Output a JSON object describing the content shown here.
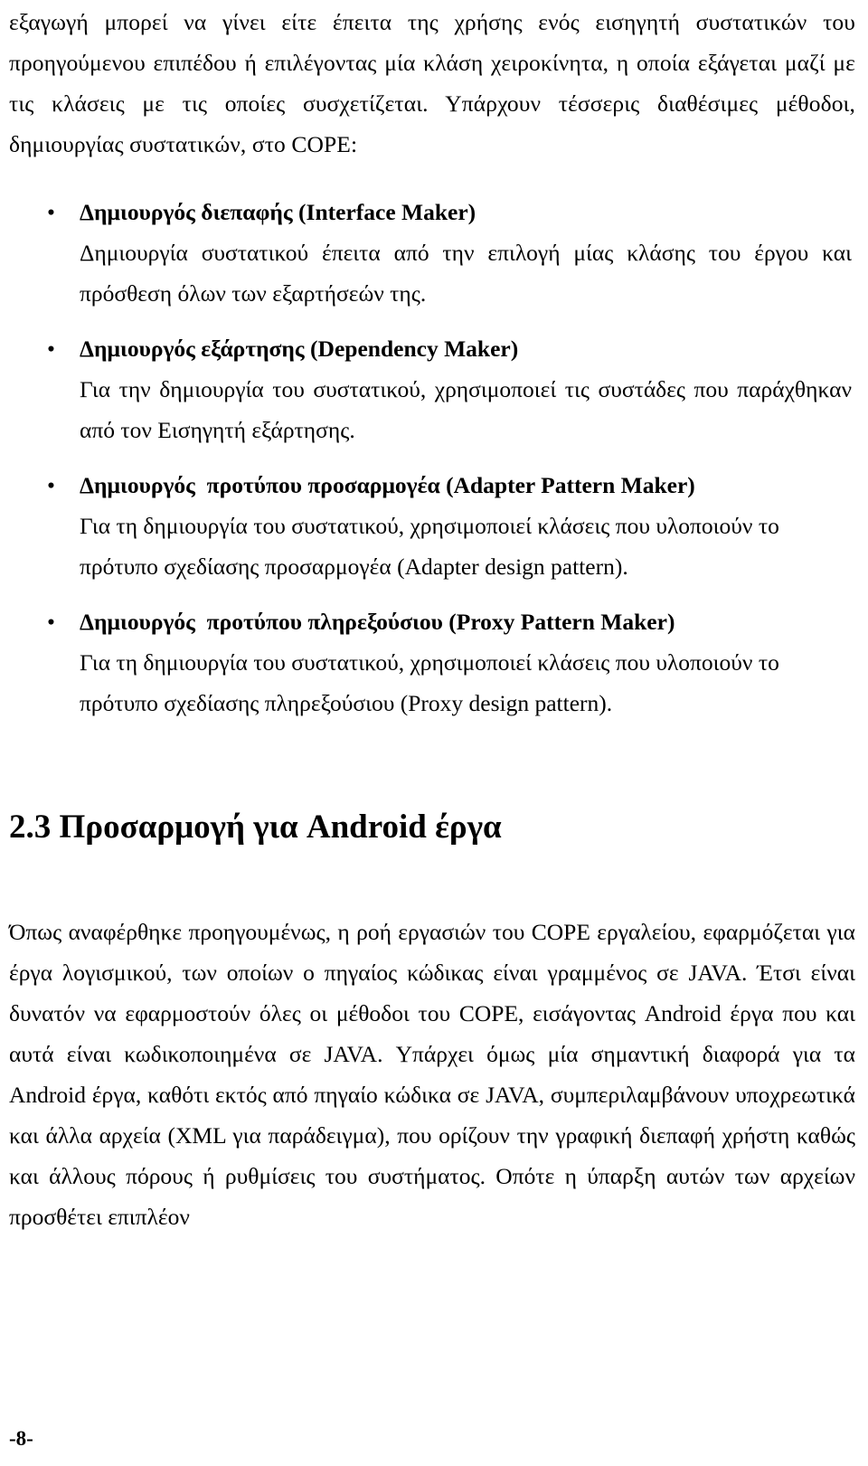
{
  "document": {
    "page_number_label": "-8-",
    "intro_paragraph": "εξαγωγή μπορεί να γίνει είτε έπειτα της χρήσης ενός εισηγητή συστατικών του προηγούμενου επιπέδου ή επιλέγοντας μία κλάση χειροκίνητα, η οποία εξάγεται μαζί με τις κλάσεις με τις οποίες συσχετίζεται. Υπάρχουν τέσσερις διαθέσιμες μέθοδοι, δημιουργίας συστατικών, στο COPE:",
    "bullet_marker": "•",
    "bullets": [
      {
        "title": "Δημιουργός διεπαφής (Interface Maker)",
        "body": "Δημιουργία συστατικού έπειτα από την επιλογή μίας κλάσης του έργου και πρόσθεση όλων των εξαρτήσεών της."
      },
      {
        "title": "Δημιουργός εξάρτησης (Dependency Maker)",
        "body": "Για την δημιουργία του συστατικού, χρησιμοποιεί τις συστάδες που παράχθηκαν από τον Εισηγητή εξάρτησης."
      },
      {
        "title": "Δημιουργός  προτύπου προσαρμογέα (Adapter Pattern Maker)",
        "body": "Για τη δημιουργία του συστατικού, χρησιμοποιεί κλάσεις που υλοποιούν το πρότυπο σχεδίασης προσαρμογέα (Adapter design pattern)."
      },
      {
        "title": "Δημιουργός  προτύπου πληρεξούσιου (Proxy Pattern Maker)",
        "body": "Για τη δημιουργία του συστατικού, χρησιμοποιεί κλάσεις που υλοποιούν το πρότυπο σχεδίασης πληρεξούσιου (Proxy design pattern)."
      }
    ],
    "section_heading": "2.3 Προσαρμογή για Android έργα",
    "closing_paragraph": "Όπως αναφέρθηκε προηγουμένως, η ροή εργασιών του COPE εργαλείου, εφαρμόζεται για έργα λογισμικού, των οποίων ο πηγαίος κώδικας είναι γραμμένος σε JAVA. Έτσι είναι δυνατόν να εφαρμοστούν όλες οι μέθοδοι του COPE, εισάγοντας Android έργα που και αυτά είναι κωδικοποιημένα σε JAVA. Υπάρχει όμως μία σημαντική διαφορά για τα Android έργα, καθότι εκτός από πηγαίο κώδικα σε JAVA, συμπεριλαμβάνουν υποχρεωτικά και άλλα αρχεία (XML για παράδειγμα), που ορίζουν την γραφική διεπαφή χρήστη καθώς και άλλους πόρους ή ρυθμίσεις του συστήματος. Οπότε η ύπαρξη αυτών των αρχείων προσθέτει επιπλέον"
  }
}
